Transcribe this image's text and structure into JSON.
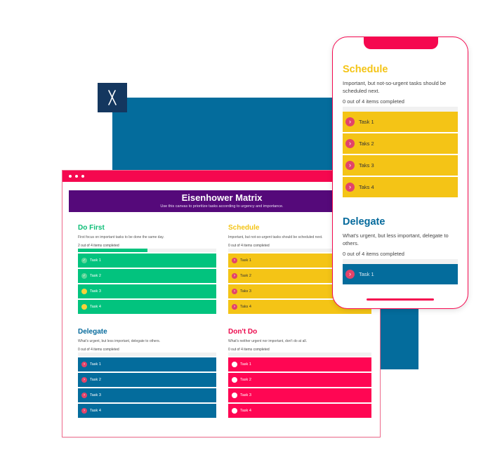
{
  "colors": {
    "blue": "#046c9c",
    "navy": "#14375f",
    "pink": "#f5084f",
    "purple": "#55097a",
    "green": "#02c37e",
    "yellow": "#f4c416",
    "red": "#ff0653"
  },
  "icons": {
    "logo": "x-mark-icon",
    "check": "check-icon",
    "chevron": "chevron-right-icon"
  },
  "desktop": {
    "header": {
      "title": "Eisenhower Matrix",
      "subtitle": "Use this canvas to prioritize tasks according to urgency and importance."
    },
    "quadrants": {
      "do_first": {
        "title": "Do First",
        "description": "First focus on important tasks to be done the same day.",
        "count": "2 out of 4 items completed",
        "progress": 0.5,
        "items": [
          "Task 1",
          "Task 2",
          "Task 3",
          "Task 4"
        ]
      },
      "schedule": {
        "title": "Schedule",
        "description": "Important, but not-so-urgent tasks should be scheduled next.",
        "count": "0 out of 4 items completed",
        "progress": 0,
        "items": [
          "Task 1",
          "Task 2",
          "Taks 3",
          "Taks 4"
        ]
      },
      "delegate": {
        "title": "Delegate",
        "description": "What's urgent, but less important, delegate to others.",
        "count": "0 out of 4 items completed",
        "progress": 0,
        "items": [
          "Task 1",
          "Task 2",
          "Task 3",
          "Task 4"
        ]
      },
      "dont_do": {
        "title": "Don't Do",
        "description": "What's neither urgent nor important, don't do at all.",
        "count": "0 out of 4 items completed",
        "progress": 0,
        "items": [
          "Task 1",
          "Task 2",
          "Task 3",
          "Task 4"
        ]
      }
    }
  },
  "mobile": {
    "schedule": {
      "title": "Schedule",
      "description": "Important, but not-so-urgent tasks should be scheduled next.",
      "count": "0 out of 4 items completed",
      "items": [
        "Task 1",
        "Taks 2",
        "Taks 3",
        "Taks 4"
      ]
    },
    "delegate": {
      "title": "Delegate",
      "description": "What's urgent, but less important, delegate to others.",
      "count": "0 out of 4 items completed",
      "items": [
        "Task 1"
      ]
    }
  }
}
